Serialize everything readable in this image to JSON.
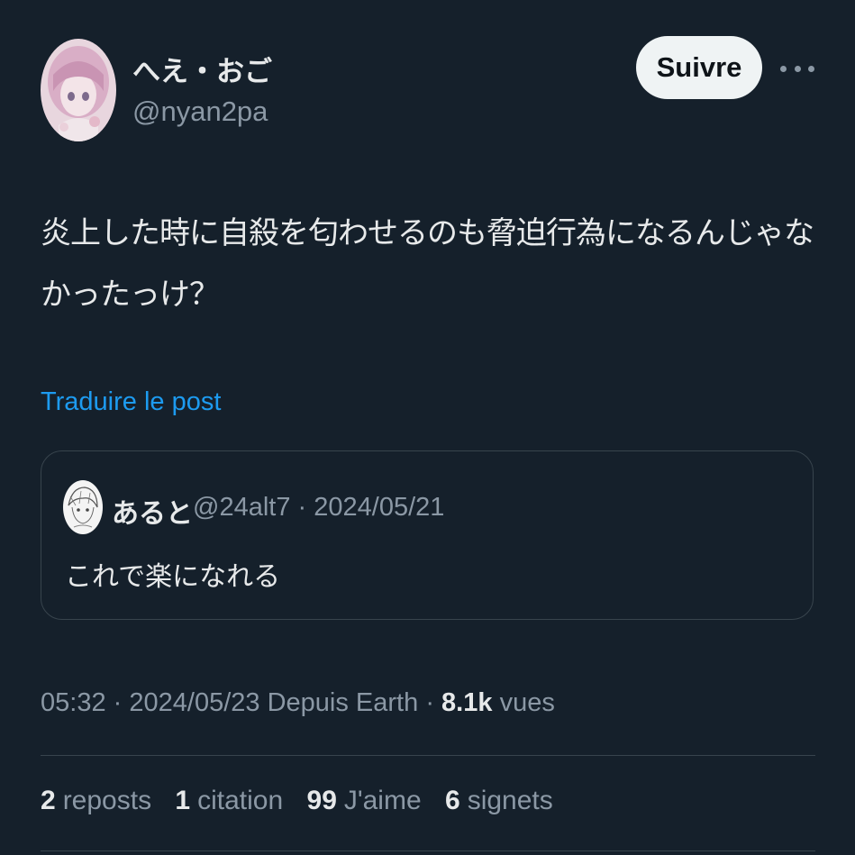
{
  "author": {
    "display_name": "へえ・おご",
    "handle": "@nyan2pa",
    "avatar_icon": "anime-girl-avatar"
  },
  "follow_label": "Suivre",
  "more_icon": "more-horizontal-icon",
  "tweet": {
    "line1": "炎上した時に自殺を匂わせるのも脅迫行為になるんじゃな",
    "line2": "かったっけ？"
  },
  "translate_label": "Traduire le post",
  "quote": {
    "display_name": "あると",
    "handle": "@24alt7",
    "separator": "·",
    "date": "2024/05/21",
    "text": "これで楽になれる",
    "avatar_icon": "sketch-avatar"
  },
  "meta": {
    "time": "05:32",
    "sep1": "·",
    "date": "2024/05/23",
    "source": "Depuis Earth",
    "sep2": "·",
    "views_count": "8.1k",
    "views_label": "vues"
  },
  "stats": [
    {
      "count": "2",
      "label": "reposts"
    },
    {
      "count": "1",
      "label": "citation"
    },
    {
      "count": "99",
      "label": "J'aime"
    },
    {
      "count": "6",
      "label": "signets"
    }
  ],
  "colors": {
    "background": "#15202b",
    "link": "#1d9bf0",
    "secondary_text": "#8b98a5",
    "primary_text": "#e7e9ea",
    "border": "#38444d"
  }
}
